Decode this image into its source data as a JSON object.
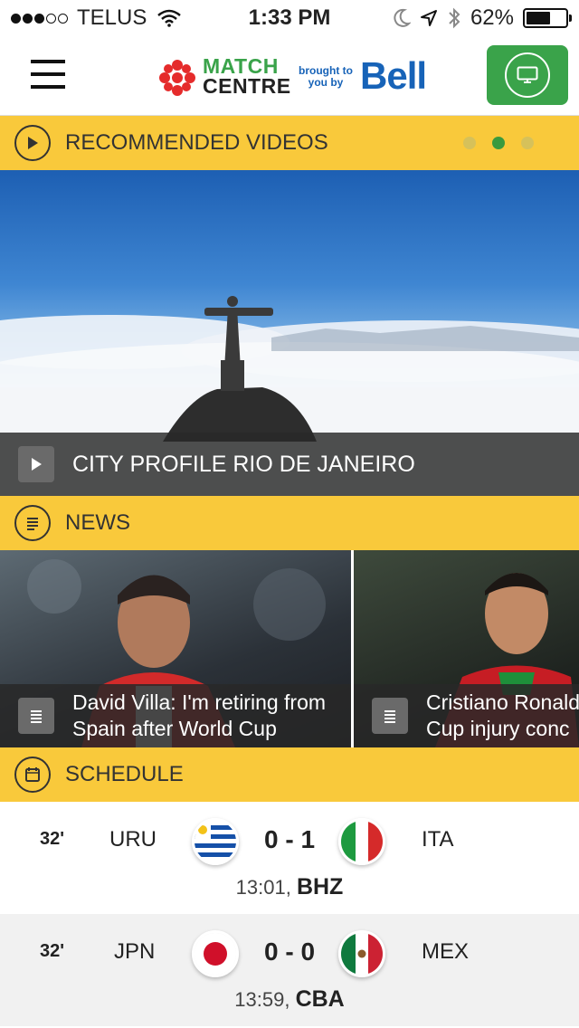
{
  "status_bar": {
    "carrier": "TELUS",
    "time": "1:33 PM",
    "battery": "62%",
    "battery_level": 0.62
  },
  "header": {
    "logo_line1": "MATCH",
    "logo_line2": "CENTRE",
    "sponsor_line1": "brought to",
    "sponsor_line2": "you by",
    "sponsor_name": "Bell"
  },
  "sections": {
    "videos": "RECOMMENDED VIDEOS",
    "news": "NEWS",
    "schedule": "SCHEDULE"
  },
  "hero": {
    "title": "CITY PROFILE RIO DE JANEIRO"
  },
  "news": [
    {
      "line1": "David Villa: I'm retiring from",
      "line2": "Spain after World Cup"
    },
    {
      "line1": "Cristiano Ronaldo",
      "line2": "Cup injury conc"
    }
  ],
  "matches": [
    {
      "minute": "32'",
      "home": "URU",
      "score": "0 - 1",
      "away": "ITA",
      "time": "13:01,",
      "venue": "BHZ"
    },
    {
      "minute": "32'",
      "home": "JPN",
      "score": "0 - 0",
      "away": "MEX",
      "time": "13:59,",
      "venue": "CBA"
    }
  ],
  "colors": {
    "section_yellow": "#f9c93b",
    "brand_green": "#3aa34a",
    "bell_blue": "#1763b8"
  },
  "icons": [
    "wifi-icon",
    "moon-icon",
    "location-arrow-icon",
    "bluetooth-icon",
    "hamburger-menu-icon",
    "tv-icon",
    "play-icon",
    "document-icon",
    "calendar-icon"
  ]
}
